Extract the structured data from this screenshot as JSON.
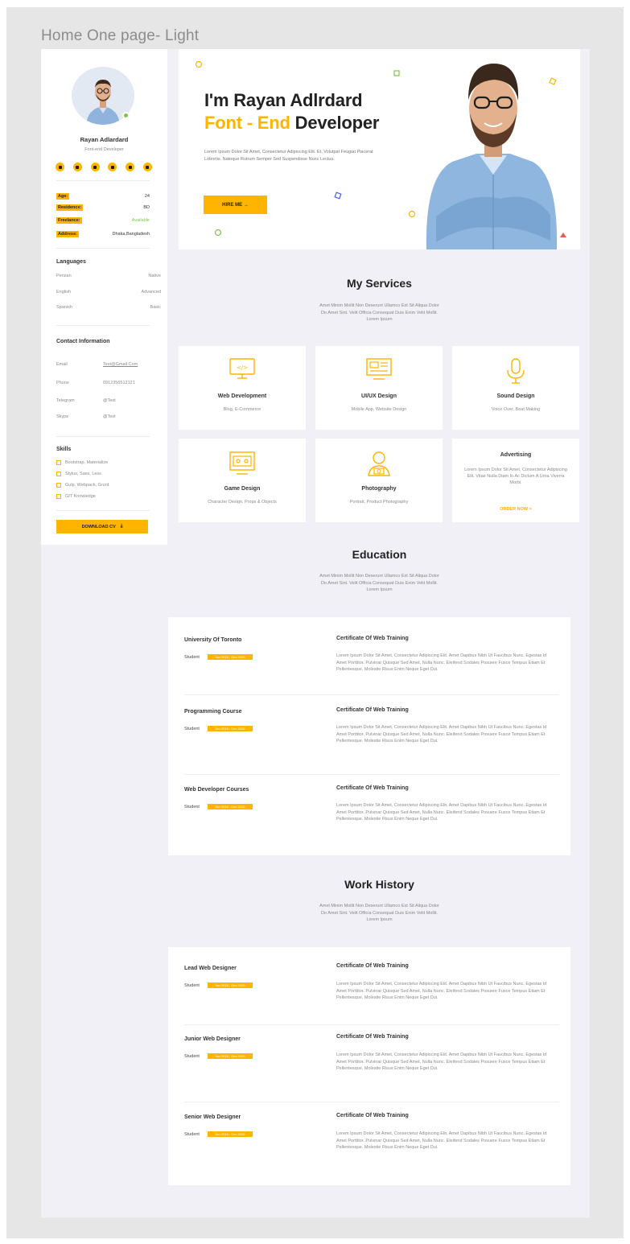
{
  "frame": {
    "title": "Home One page- Light"
  },
  "sidebar": {
    "name": "Rayan Adlardard",
    "role": "Font-end Developer",
    "socials": [
      "facebook-icon",
      "instagram-icon",
      "twitter-icon",
      "linkedin-icon",
      "youtube-icon",
      "dribbble-icon"
    ],
    "info": [
      {
        "key": "Age:",
        "value": "24"
      },
      {
        "key": "Residence:",
        "value": "BD"
      },
      {
        "key": "Freelance:",
        "value": "Available"
      },
      {
        "key": "Address:",
        "value": "Dhaka,Bangladesh"
      }
    ],
    "languages_title": "Languages",
    "languages": [
      {
        "name": "Persian",
        "level": "Native"
      },
      {
        "name": "English",
        "level": "Advanced"
      },
      {
        "name": "Spanish",
        "level": "Basic"
      }
    ],
    "contact_title": "Contact Information",
    "contact": [
      {
        "label": "Email",
        "value": "Test@Gmail.Com"
      },
      {
        "label": "Phone",
        "value": "0912356512121"
      },
      {
        "label": "Telegram",
        "value": "@Test"
      },
      {
        "label": "Skype",
        "value": "@Test"
      }
    ],
    "skills_title": "Skills",
    "skills": [
      "Bootstrap, Materialize",
      "Stylus, Sass, Less",
      "Gulp, Webpack, Grunt",
      "GIT Knowledge"
    ],
    "download_label": "DOWNLOAD CV"
  },
  "hero": {
    "line1": "I'm Rayan Adlrdard",
    "line2_accent": "Font - End",
    "line2_rest": " Developer",
    "paragraph": "Lorem Ipsum Dolor Sit Amet, Consectetur Adipiscing Elit. Et, Volutpat Feugiat Placerat Lobortis. Natoque Rutrum Semper Sed Suspendisse Nunc Lectus.",
    "hire_label": "HIRE ME →"
  },
  "services": {
    "title": "My Services",
    "subtitle": [
      "Amet Minim Mollit Non Deserunt Ullamco Est Sit Aliqua Dolor",
      "Do Amet Sint. Velit Officia Consequat Duis Enim Velit Mollit.",
      "Lorem Ipsum"
    ],
    "items": [
      {
        "title": "Web Development",
        "desc": "Blog, E-Commerce"
      },
      {
        "title": "UI/UX Design",
        "desc": "Mobile App, Website Design"
      },
      {
        "title": "Sound Design",
        "desc": "Voice Over, Beat Making"
      },
      {
        "title": "Game Design",
        "desc": "Character Design, Props & Objects"
      },
      {
        "title": "Photography",
        "desc": "Portrait, Product Photography"
      },
      {
        "title": "Advertising",
        "desc": "Lorem Ipsum Dolor Sit Amet, Consectetur Adipiscing Elit. Vitae Nulla Diam In Ac Dictum A Urna Viverra Morbi.",
        "link": "ORDER NOW >"
      }
    ]
  },
  "education": {
    "title": "Education",
    "subtitle": [
      "Amet Minim Mollit Non Deserunt Ullamco Est Sit Aliqua Dolor",
      "Do Amet Sint. Velit Officia Consequat Duis Enim Velit Mollit.",
      "Lorem Ipsum"
    ],
    "entries": [
      {
        "org": "University Of Toronto",
        "role": "Student",
        "tag": "Jan 2016 - Dec 2020",
        "cert": "Certificate Of Web Training",
        "desc": "Lorem Ipsum Dolor Sit Amet, Consectetur Adipiscing Elit. Amet Dapibus Nibh Ut Faucibus Nunc. Egestas Id Amet Porttitor. Pulvinar Quisque Sed Amet, Nulla Nunc. Eleifend Sodales Posuere Fusce Tempus Etiam Et Pellentesque. Molestie Risus Enim Neque Eget Dui."
      },
      {
        "org": "Programming Course",
        "role": "Student",
        "tag": "Jan 2016 - Dec 2020",
        "cert": "Certificate Of Web Training",
        "desc": "Lorem Ipsum Dolor Sit Amet, Consectetur Adipiscing Elit. Amet Dapibus Nibh Ut Faucibus Nunc. Egestas Id Amet Porttitor. Pulvinar Quisque Sed Amet, Nulla Nunc. Eleifend Sodales Posuere Fusce Tempus Etiam Et Pellentesque. Molestie Risus Enim Neque Eget Dui."
      },
      {
        "org": "Web Developer Courses",
        "role": "Student",
        "tag": "Jan 2016 - Dec 2020",
        "cert": "Certificate Of Web Training",
        "desc": "Lorem Ipsum Dolor Sit Amet, Consectetur Adipiscing Elit. Amet Dapibus Nibh Ut Faucibus Nunc. Egestas Id Amet Porttitor. Pulvinar Quisque Sed Amet, Nulla Nunc. Eleifend Sodales Posuere Fusce Tempus Etiam Et Pellentesque. Molestie Risus Enim Neque Eget Dui."
      }
    ]
  },
  "work": {
    "title": "Work History",
    "subtitle": [
      "Amet Minim Mollit Non Deserunt Ullamco Est Sit Aliqua Dolor",
      "Do Amet Sint. Velit Officia Consequat Duis Enim Velit Mollit.",
      "Lorem Ipsum"
    ],
    "entries": [
      {
        "org": "Lead Web Designer",
        "role": "Student",
        "tag": "Jan 2016 - Dec 2020",
        "cert": "Certificate Of Web Training",
        "desc": "Lorem Ipsum Dolor Sit Amet, Consectetur Adipiscing Elit. Amet Dapibus Nibh Ut Faucibus Nunc. Egestas Id Amet Porttitor. Pulvinar Quisque Sed Amet, Nulla Nunc. Eleifend Sodales Posuere Fusce Tempus Etiam Et Pellentesque. Molestie Risus Enim Neque Eget Dui."
      },
      {
        "org": "Junior Web Designer",
        "role": "Student",
        "tag": "Jan 2016 - Dec 2020",
        "cert": "Certificate Of Web Training",
        "desc": "Lorem Ipsum Dolor Sit Amet, Consectetur Adipiscing Elit. Amet Dapibus Nibh Ut Faucibus Nunc. Egestas Id Amet Porttitor. Pulvinar Quisque Sed Amet, Nulla Nunc. Eleifend Sodales Posuere Fusce Tempus Etiam Et Pellentesque. Molestie Risus Enim Neque Eget Dui."
      },
      {
        "org": "Senior Web Designer",
        "role": "Student",
        "tag": "Jan 2016 - Dec 2020",
        "cert": "Certificate Of Web Training",
        "desc": "Lorem Ipsum Dolor Sit Amet, Consectetur Adipiscing Elit. Amet Dapibus Nibh Ut Faucibus Nunc. Egestas Id Amet Porttitor. Pulvinar Quisque Sed Amet, Nulla Nunc. Eleifend Sodales Posuere Fusce Tempus Etiam Et Pellentesque. Molestie Risus Enim Neque Eget Dui."
      }
    ]
  },
  "colors": {
    "accent": "#ffb400",
    "background": "#f0f0f6",
    "green": "#7ec64a",
    "text": "#2b2b2b"
  }
}
